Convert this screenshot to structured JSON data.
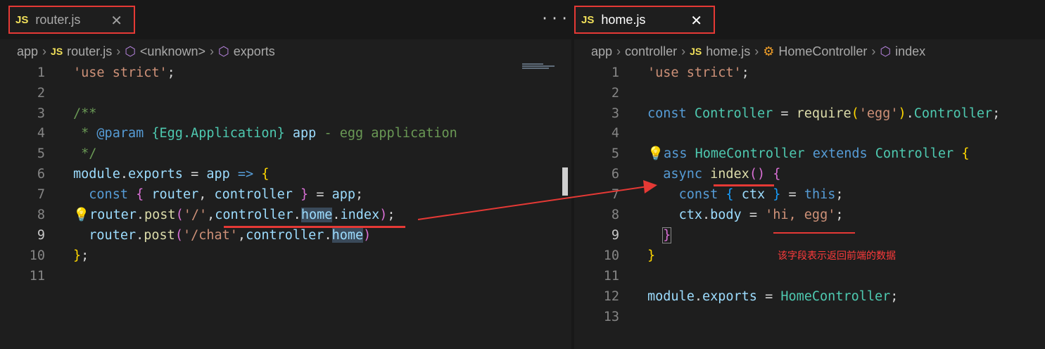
{
  "left": {
    "tab": {
      "icon": "JS",
      "label": "router.js",
      "close": "✕"
    },
    "more": "···",
    "breadcrumb": {
      "folder": "app",
      "file_icon": "JS",
      "file": "router.js",
      "symbol1": "<unknown>",
      "symbol2": "exports"
    },
    "line_numbers": [
      "1",
      "2",
      "3",
      "4",
      "5",
      "6",
      "7",
      "8",
      "9",
      "10",
      "11"
    ]
  },
  "right": {
    "tab": {
      "icon": "JS",
      "label": "home.js",
      "close": "✕"
    },
    "breadcrumb": {
      "folder1": "app",
      "folder2": "controller",
      "file_icon": "JS",
      "file": "home.js",
      "class": "HomeController",
      "method": "index"
    },
    "line_numbers": [
      "1",
      "2",
      "3",
      "4",
      "5",
      "6",
      "7",
      "8",
      "9",
      "10",
      "11",
      "12",
      "13"
    ]
  },
  "annotation": "该字段表示返回前端的数据",
  "colors": {
    "highlight_box": "#e53935",
    "annotation": "#ff3b3b"
  }
}
